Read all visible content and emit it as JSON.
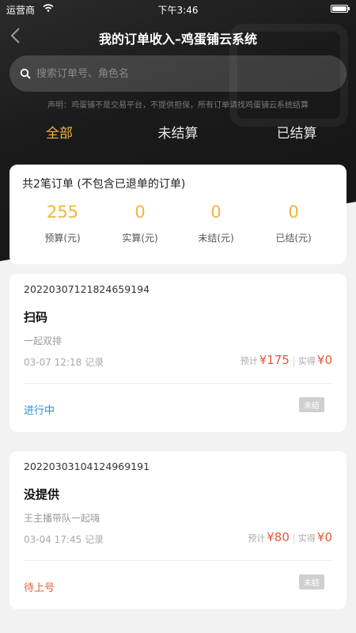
{
  "status_bar": {
    "carrier": "运营商",
    "time": "下午3:46"
  },
  "nav": {
    "title": "我的订单收入–鸡蛋铺云系统"
  },
  "search": {
    "placeholder": "搜索订单号、角色名"
  },
  "disclaimer": "声明：鸡蛋铺不是交易平台，不提供担保，所有订单请找鸡蛋铺云系统结算",
  "tabs": [
    {
      "label": "全部",
      "active": true
    },
    {
      "label": "未结算",
      "active": false
    },
    {
      "label": "已结算",
      "active": false
    }
  ],
  "summary": {
    "title": "共2笔订单 (不包含已退单的订单)",
    "stats": [
      {
        "value": "255",
        "label": "预算(元)"
      },
      {
        "value": "0",
        "label": "实算(元)"
      },
      {
        "value": "0",
        "label": "未结(元)"
      },
      {
        "value": "0",
        "label": "已结(元)"
      }
    ]
  },
  "orders": [
    {
      "order_no": "20220307121824659194",
      "name": "扫码",
      "subtitle": "一起双排",
      "time": "03-07 12:18 记录",
      "estimate_label": "预计",
      "estimate_amount": "¥175",
      "actual_label": "实得",
      "actual_amount": "¥0",
      "status": "进行中",
      "status_color": "#2a8fd6",
      "badge": "未结"
    },
    {
      "order_no": "20220303104124969191",
      "name": "没提供",
      "subtitle": "王主播带队一起嗨",
      "time": "03-04 17:45 记录",
      "estimate_label": "预计",
      "estimate_amount": "¥80",
      "actual_label": "实得",
      "actual_amount": "¥0",
      "status": "待上号",
      "status_color": "#e0603a",
      "badge": "未结"
    }
  ],
  "colors": {
    "accent": "#f0b53c",
    "amount": "#e05a3a",
    "status_in_progress": "#2a8fd6",
    "status_waiting": "#e0603a"
  },
  "icons": [
    "wifi-icon",
    "battery-icon",
    "back-icon",
    "search-icon"
  ]
}
